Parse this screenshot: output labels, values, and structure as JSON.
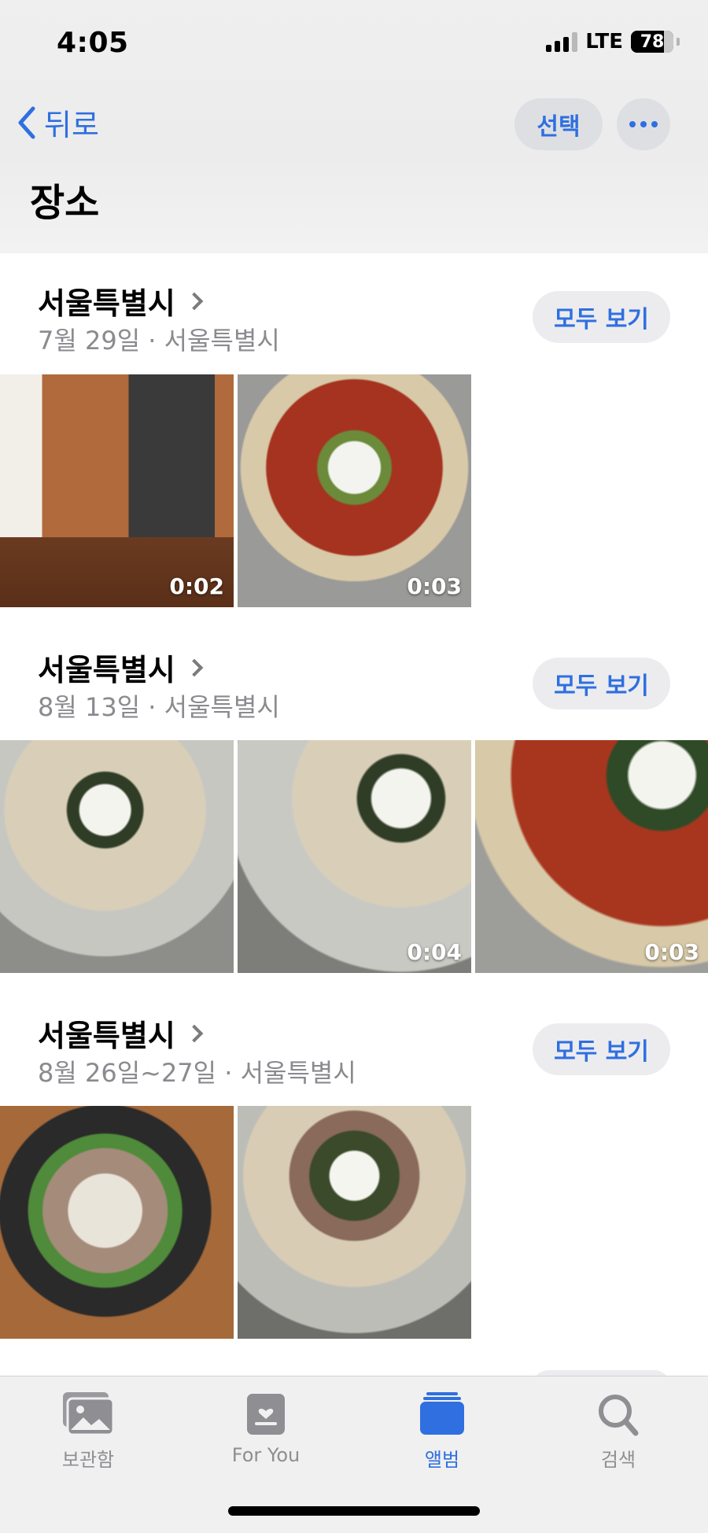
{
  "status_bar": {
    "time": "4:05",
    "network": "LTE",
    "battery": "78"
  },
  "nav": {
    "back_label": "뒤로",
    "select_label": "선택",
    "title": "장소"
  },
  "sections": [
    {
      "title": "서울특별시",
      "subtitle": "7월 29일 · 서울특별시",
      "see_all": "모두 보기",
      "photos": [
        {
          "duration": "0:02"
        },
        {
          "duration": "0:03"
        }
      ]
    },
    {
      "title": "서울특별시",
      "subtitle": "8월 13일 · 서울특별시",
      "see_all": "모두 보기",
      "photos": [
        {
          "duration": ""
        },
        {
          "duration": "0:04"
        },
        {
          "duration": "0:03"
        }
      ]
    },
    {
      "title": "서울특별시",
      "subtitle": "8월 26일~27일 · 서울특별시",
      "see_all": "모두 보기",
      "photos": [
        {
          "duration": ""
        },
        {
          "duration": ""
        }
      ]
    }
  ],
  "tabbar": {
    "items": [
      {
        "label": "보관함",
        "icon": "photo-library-icon"
      },
      {
        "label": "For You",
        "icon": "for-you-icon"
      },
      {
        "label": "앨범",
        "icon": "albums-icon"
      },
      {
        "label": "검색",
        "icon": "search-icon"
      }
    ],
    "active_index": 2
  },
  "colors": {
    "accent": "#2f6fe0",
    "inactive": "#8e8e93"
  }
}
